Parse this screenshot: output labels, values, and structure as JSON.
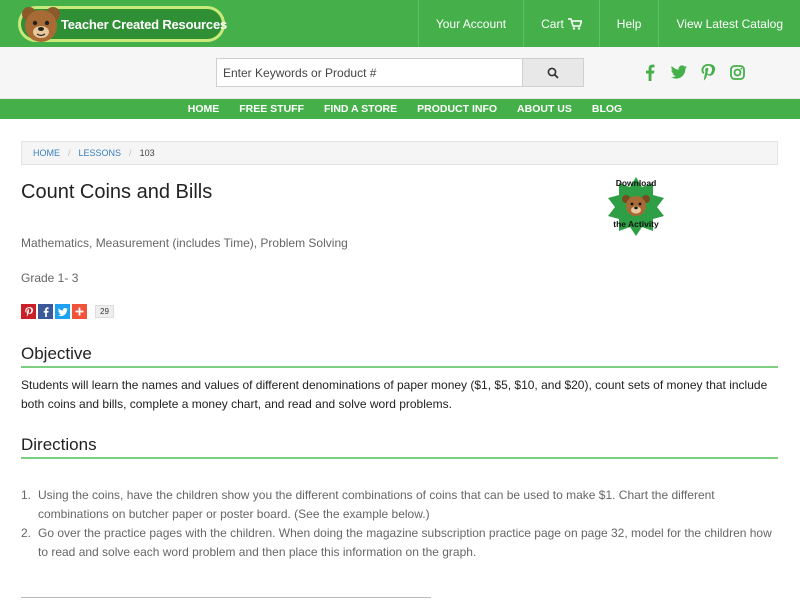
{
  "header": {
    "logo_text": "Teacher Created Resources",
    "nav": [
      {
        "label": "Your Account"
      },
      {
        "label": "Cart"
      },
      {
        "label": "Help"
      },
      {
        "label": "View Latest Catalog"
      }
    ],
    "brand_color": "#45b04a"
  },
  "search": {
    "placeholder": "Enter Keywords or Product #",
    "button_icon": "search-icon"
  },
  "social": [
    "facebook-icon",
    "twitter-icon",
    "pinterest-icon",
    "instagram-icon"
  ],
  "main_nav": [
    {
      "label": "HOME"
    },
    {
      "label": "FREE STUFF"
    },
    {
      "label": "FIND A STORE"
    },
    {
      "label": "PRODUCT INFO"
    },
    {
      "label": "ABOUT US"
    },
    {
      "label": "BLOG"
    }
  ],
  "breadcrumb": [
    {
      "label": "HOME"
    },
    {
      "label": "LESSONS"
    },
    {
      "label": "103"
    }
  ],
  "lesson": {
    "title": "Count Coins and Bills",
    "download_label_top": "Download",
    "download_label_bottom": "the Activity",
    "subjects": "Mathematics, Measurement (includes Time), Problem Solving",
    "grade": "Grade 1- 3",
    "share_count": "29",
    "objective_heading": "Objective",
    "objective_text": "Students will learn the names and values of different denominations of paper money ($1, $5, $10, and $20), count sets of money that include both coins and bills, complete a money chart, and read and solve word problems.",
    "directions_heading": "Directions",
    "directions": [
      {
        "num": "1.",
        "text": "Using the coins, have the children show you the different combinations of coins that can be used to make $1. Chart the different combinations on butcher paper or poster board. (See the example below.)"
      },
      {
        "num": "2.",
        "text": "Go over the practice pages with the children. When doing the magazine subscription practice page on page 32, model for the children how to read and solve each word problem and then place this information on the graph."
      }
    ]
  }
}
